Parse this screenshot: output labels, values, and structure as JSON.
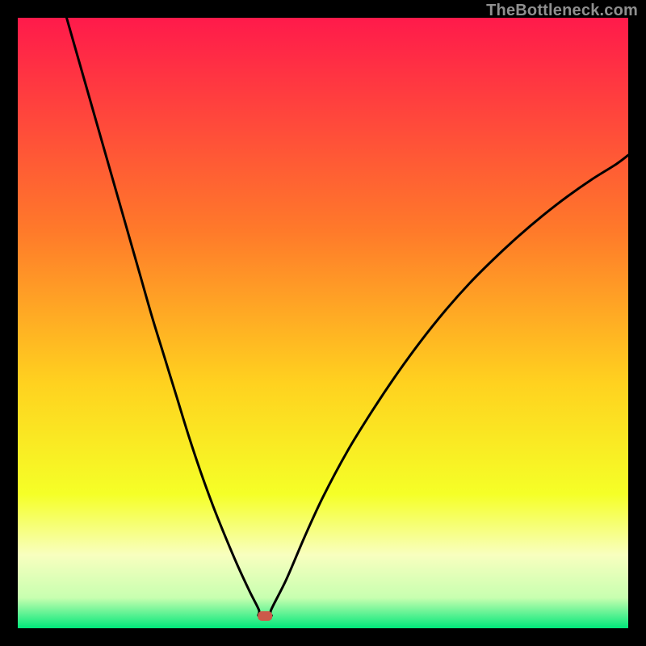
{
  "watermark": "TheBottleneck.com",
  "chart_data": {
    "type": "line",
    "title": "",
    "xlabel": "",
    "ylabel": "",
    "xlim": [
      0,
      100
    ],
    "ylim": [
      0,
      100
    ],
    "grid": false,
    "legend": false,
    "annotations": [],
    "gradient_stops": [
      {
        "pos": 0,
        "color": "#ff1a4b"
      },
      {
        "pos": 35,
        "color": "#ff7a2a"
      },
      {
        "pos": 60,
        "color": "#ffd21f"
      },
      {
        "pos": 78,
        "color": "#f5ff27"
      },
      {
        "pos": 88,
        "color": "#f8ffbf"
      },
      {
        "pos": 95,
        "color": "#c8ffb0"
      },
      {
        "pos": 100,
        "color": "#00e77a"
      }
    ],
    "minimum_marker": {
      "x": 40.5,
      "y": 2,
      "color": "#cc5a4a"
    },
    "series": [
      {
        "name": "left-branch",
        "x": [
          8,
          10,
          12,
          14,
          16,
          18,
          20,
          22,
          24,
          26,
          28,
          30,
          32,
          34,
          36,
          38,
          39.5
        ],
        "y": [
          100,
          93,
          86,
          79,
          72,
          65,
          58,
          51,
          44.5,
          38,
          31.5,
          25.5,
          20,
          15,
          10.3,
          6,
          3
        ]
      },
      {
        "name": "valley-flat",
        "x": [
          39.5,
          41.5
        ],
        "y": [
          2,
          2
        ]
      },
      {
        "name": "right-branch",
        "x": [
          41.5,
          44,
          47,
          50,
          54,
          58,
          62,
          66,
          70,
          74,
          78,
          82,
          86,
          90,
          94,
          98,
          100
        ],
        "y": [
          3,
          8,
          15,
          21.5,
          29,
          35.5,
          41.5,
          47,
          52,
          56.5,
          60.5,
          64.2,
          67.6,
          70.7,
          73.5,
          76,
          77.5
        ]
      }
    ]
  }
}
